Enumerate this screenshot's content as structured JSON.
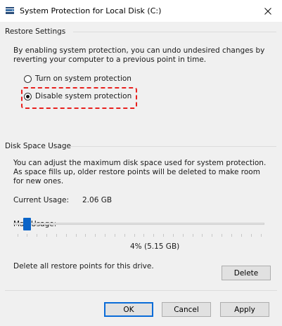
{
  "window": {
    "title": "System Protection for Local Disk (C:)",
    "close_glyph": "✕"
  },
  "restore_settings": {
    "heading": "Restore Settings",
    "description": "By enabling system protection, you can undo undesired changes by reverting your computer to a previous point in time.",
    "options": [
      {
        "label": "Turn on system protection",
        "selected": false
      },
      {
        "label": "Disable system protection",
        "selected": true
      }
    ]
  },
  "disk_space": {
    "heading": "Disk Space Usage",
    "description": "You can adjust the maximum disk space used for system protection. As space fills up, older restore points will be deleted to make room for new ones.",
    "current_usage_label": "Current Usage:",
    "current_usage_value": "2.06 GB",
    "max_usage_label": "Max Usage:",
    "max_usage_value": "4% (5.15 GB)",
    "max_usage_percent": 4,
    "delete_text": "Delete all restore points for this drive.",
    "delete_button": "Delete"
  },
  "buttons": {
    "ok": "OK",
    "cancel": "Cancel",
    "apply": "Apply"
  },
  "colors": {
    "accent": "#0a64c8",
    "highlight": "#e8201e"
  }
}
